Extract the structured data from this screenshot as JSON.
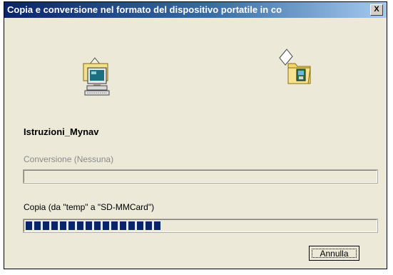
{
  "window": {
    "title": "Copia e conversione nel formato del dispositivo portatile in co",
    "close_label": "X"
  },
  "icons": {
    "source": "computer-icon",
    "destination": "folder-device-icon"
  },
  "file": {
    "name": "Istruzioni_Mynav"
  },
  "conversion": {
    "label": "Conversione (Nessuna)",
    "progress": 0
  },
  "copy": {
    "label": "Copia (da \"temp\" a \"SD-MMCard\")",
    "progress": 0.4,
    "chunks": 16
  },
  "buttons": {
    "cancel": "Annulla"
  }
}
